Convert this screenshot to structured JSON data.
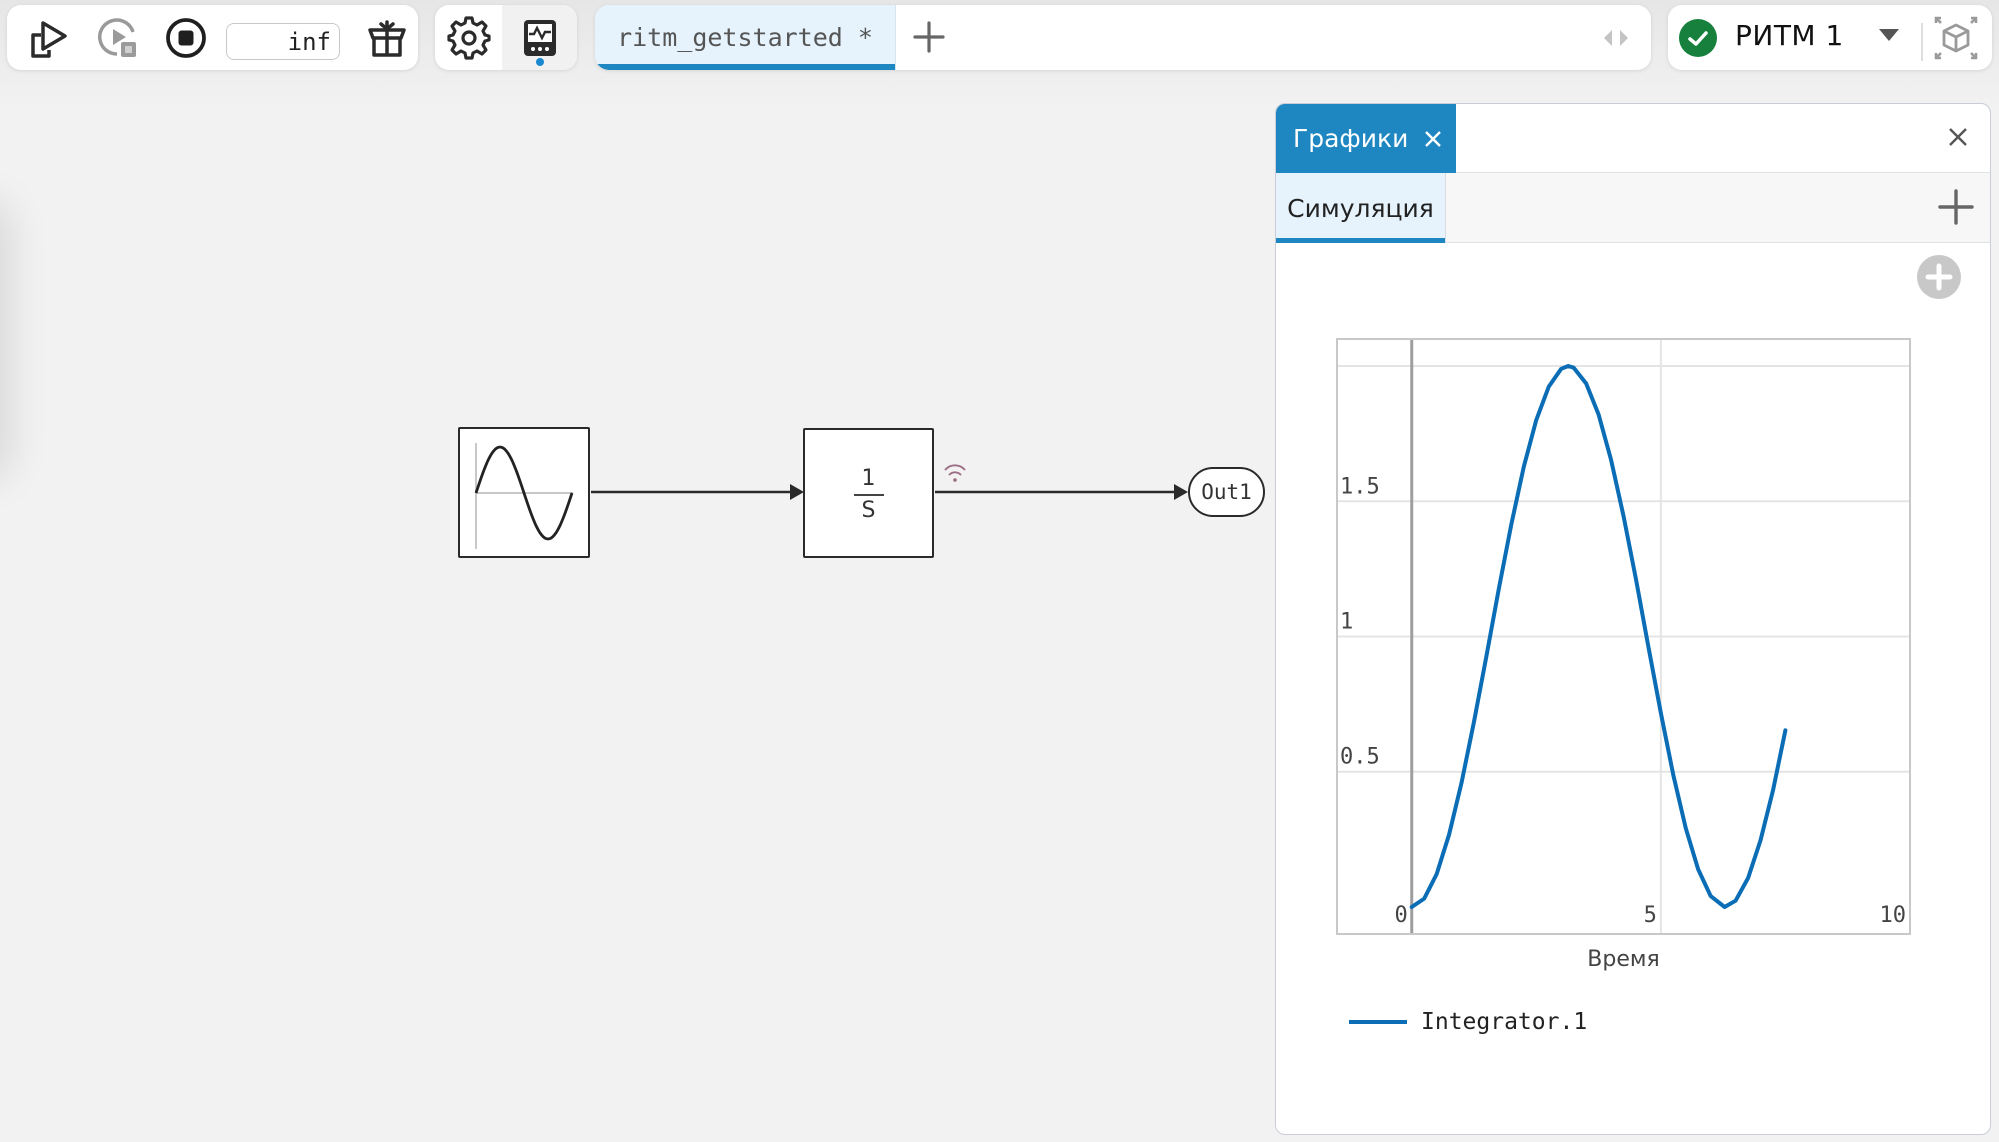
{
  "toolbar": {
    "run_icon": "run-icon",
    "run_hardware_icon": "run-on-hardware-icon",
    "stop_icon": "stop-icon",
    "sim_time_value": "inf",
    "package_icon": "package-icon",
    "settings_icon": "gear-icon",
    "scope_icon": "scope-icon"
  },
  "tabs": {
    "items": [
      {
        "label": "ritm_getstarted *",
        "active": true
      }
    ],
    "add_icon": "plus-icon",
    "scroll_icon": "scroll-arrows-icon"
  },
  "status": {
    "label": "РИТМ 1",
    "state": "connected",
    "state_color": "#16803c",
    "dropdown_icon": "caret-down-icon",
    "cube_icon": "3d-view-icon"
  },
  "diagram": {
    "blocks": [
      {
        "type": "sine-wave",
        "name": "Sine Wave"
      },
      {
        "type": "integrator",
        "numerator": "1",
        "denominator": "S"
      },
      {
        "type": "outport",
        "label": "Out1"
      }
    ],
    "signal_logged_icon": "wifi-signal-icon"
  },
  "panel": {
    "tab_label": "Графики",
    "sub_tab_label": "Симуляция",
    "accent_color": "#1e86c0"
  },
  "chart_data": {
    "type": "line",
    "title": "",
    "xlabel": "Время",
    "ylabel": "",
    "xlim": [
      -1.5,
      10
    ],
    "ylim": [
      -0.1,
      2.1
    ],
    "x_ticks": [
      0,
      5,
      10
    ],
    "x_tick_labels": [
      "0",
      "5",
      "10"
    ],
    "y_ticks": [
      0.5,
      1,
      1.5
    ],
    "y_tick_labels": [
      "0.5",
      "1",
      "1.5"
    ],
    "y_gridlines": [
      0.5,
      1,
      1.5,
      2
    ],
    "grid": true,
    "legend_position": "bottom-left",
    "series": [
      {
        "name": "Integrator.1",
        "color": "#0a6db5",
        "x": [
          0,
          0.25,
          0.5,
          0.75,
          1,
          1.25,
          1.5,
          1.75,
          2,
          2.25,
          2.5,
          2.75,
          3,
          3.14,
          3.25,
          3.5,
          3.75,
          4,
          4.25,
          4.5,
          4.75,
          5,
          5.25,
          5.5,
          5.75,
          6,
          6.28,
          6.5,
          6.75,
          7,
          7.25,
          7.5
        ],
        "y": [
          0,
          0.031,
          0.122,
          0.268,
          0.46,
          0.685,
          0.929,
          1.178,
          1.416,
          1.628,
          1.801,
          1.924,
          1.99,
          2.0,
          1.994,
          1.936,
          1.821,
          1.654,
          1.446,
          1.211,
          0.962,
          0.716,
          0.488,
          0.291,
          0.139,
          0.04,
          0.0,
          0.023,
          0.107,
          0.246,
          0.431,
          0.653
        ]
      }
    ]
  }
}
